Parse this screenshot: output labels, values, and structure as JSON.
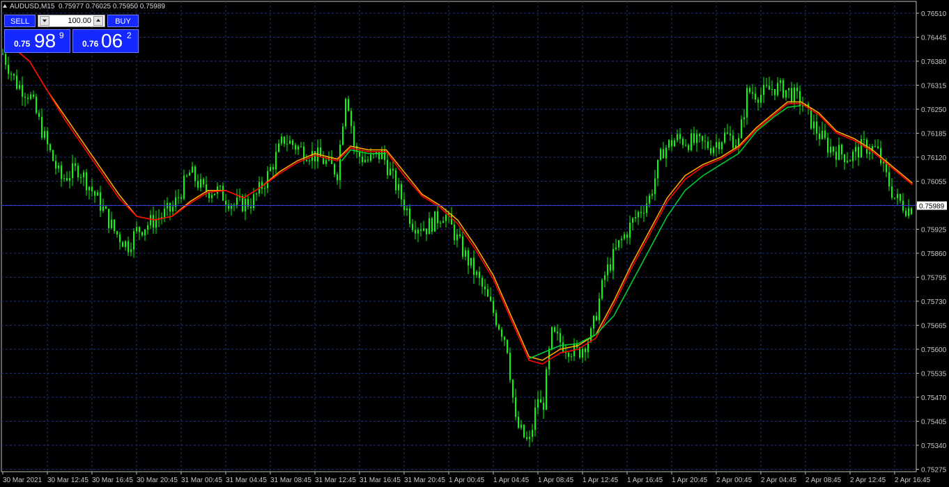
{
  "header": {
    "symbol": "AUDUSD,M15",
    "ohlc": "0.75977 0.76025 0.75950 0.75989"
  },
  "trade_panel": {
    "sell_label": "SELL",
    "buy_label": "BUY",
    "lot_value": "100.00",
    "sell_price": {
      "small": "0.75",
      "big": "98",
      "sup": "9"
    },
    "buy_price": {
      "small": "0.76",
      "big": "06",
      "sup": "2"
    }
  },
  "colors": {
    "background": "#000000",
    "grid": "#23306e",
    "axis": "#c0c0c0",
    "candle": "#00ff00",
    "ma_fast": "#ffa500",
    "ma_slow": "#ff0000",
    "ma_green": "#00cc33",
    "price_line": "#3a3ad0",
    "panel_blue": "#1428ff"
  },
  "chart_data": {
    "type": "candlestick",
    "symbol": "AUDUSD",
    "timeframe": "M15",
    "y_ticks": [
      "0.76510",
      "0.76445",
      "0.76380",
      "0.76315",
      "0.76250",
      "0.76185",
      "0.76120",
      "0.76055",
      "0.75990",
      "0.75925",
      "0.75860",
      "0.75795",
      "0.75730",
      "0.75665",
      "0.75600",
      "0.75535",
      "0.75470",
      "0.75405",
      "0.75340",
      "0.75275"
    ],
    "ylim": [
      0.75275,
      0.7651
    ],
    "x_ticks": [
      "30 Mar 2021",
      "30 Mar 12:45",
      "30 Mar 16:45",
      "30 Mar 20:45",
      "31 Mar 00:45",
      "31 Mar 04:45",
      "31 Mar 08:45",
      "31 Mar 12:45",
      "31 Mar 16:45",
      "31 Mar 20:45",
      "1 Apr 00:45",
      "1 Apr 04:45",
      "1 Apr 08:45",
      "1 Apr 12:45",
      "1 Apr 16:45",
      "1 Apr 20:45",
      "2 Apr 00:45",
      "2 Apr 04:45",
      "2 Apr 08:45",
      "2 Apr 12:45",
      "2 Apr 16:45"
    ],
    "current_price": "0.75989",
    "close_series": [
      {
        "t": 0,
        "v": 0.764
      },
      {
        "t": 0.3,
        "v": 0.7632
      },
      {
        "t": 0.6,
        "v": 0.7629
      },
      {
        "t": 1.0,
        "v": 0.7615
      },
      {
        "t": 1.3,
        "v": 0.7606
      },
      {
        "t": 1.7,
        "v": 0.7609
      },
      {
        "t": 2.0,
        "v": 0.7603
      },
      {
        "t": 2.2,
        "v": 0.7599
      },
      {
        "t": 2.5,
        "v": 0.7592
      },
      {
        "t": 2.8,
        "v": 0.7588
      },
      {
        "t": 3.0,
        "v": 0.7592
      },
      {
        "t": 3.4,
        "v": 0.7595
      },
      {
        "t": 3.8,
        "v": 0.7598
      },
      {
        "t": 4.2,
        "v": 0.7608
      },
      {
        "t": 4.5,
        "v": 0.7603
      },
      {
        "t": 4.8,
        "v": 0.7603
      },
      {
        "t": 5.2,
        "v": 0.7599
      },
      {
        "t": 5.6,
        "v": 0.76
      },
      {
        "t": 5.9,
        "v": 0.7606
      },
      {
        "t": 6.3,
        "v": 0.7617
      },
      {
        "t": 6.7,
        "v": 0.7614
      },
      {
        "t": 7.1,
        "v": 0.7612
      },
      {
        "t": 7.5,
        "v": 0.7608
      },
      {
        "t": 7.7,
        "v": 0.7631
      },
      {
        "t": 7.9,
        "v": 0.7613
      },
      {
        "t": 8.2,
        "v": 0.7611
      },
      {
        "t": 8.5,
        "v": 0.7613
      },
      {
        "t": 8.9,
        "v": 0.7602
      },
      {
        "t": 9.2,
        "v": 0.7594
      },
      {
        "t": 9.5,
        "v": 0.7593
      },
      {
        "t": 9.9,
        "v": 0.7597
      },
      {
        "t": 10.3,
        "v": 0.7587
      },
      {
        "t": 10.7,
        "v": 0.7578
      },
      {
        "t": 11.0,
        "v": 0.757
      },
      {
        "t": 11.3,
        "v": 0.7562
      },
      {
        "t": 11.5,
        "v": 0.754
      },
      {
        "t": 11.8,
        "v": 0.7534
      },
      {
        "t": 12.0,
        "v": 0.7547
      },
      {
        "t": 12.1,
        "v": 0.7543
      },
      {
        "t": 12.3,
        "v": 0.7564
      },
      {
        "t": 12.6,
        "v": 0.7561
      },
      {
        "t": 12.9,
        "v": 0.7559
      },
      {
        "t": 13.2,
        "v": 0.7564
      },
      {
        "t": 13.5,
        "v": 0.758
      },
      {
        "t": 13.8,
        "v": 0.7588
      },
      {
        "t": 14.2,
        "v": 0.7596
      },
      {
        "t": 14.5,
        "v": 0.7601
      },
      {
        "t": 14.8,
        "v": 0.7614
      },
      {
        "t": 15.1,
        "v": 0.7617
      },
      {
        "t": 15.5,
        "v": 0.7616
      },
      {
        "t": 15.9,
        "v": 0.7615
      },
      {
        "t": 16.2,
        "v": 0.7618
      },
      {
        "t": 16.5,
        "v": 0.7616
      },
      {
        "t": 16.7,
        "v": 0.763
      },
      {
        "t": 17.0,
        "v": 0.7629
      },
      {
        "t": 17.3,
        "v": 0.7631
      },
      {
        "t": 17.6,
        "v": 0.763
      },
      {
        "t": 17.9,
        "v": 0.7627
      },
      {
        "t": 18.2,
        "v": 0.762
      },
      {
        "t": 18.5,
        "v": 0.7615
      },
      {
        "t": 18.8,
        "v": 0.7613
      },
      {
        "t": 19.0,
        "v": 0.7612
      },
      {
        "t": 19.3,
        "v": 0.7615
      },
      {
        "t": 19.6,
        "v": 0.7614
      },
      {
        "t": 19.8,
        "v": 0.7607
      },
      {
        "t": 20.0,
        "v": 0.7601
      },
      {
        "t": 20.3,
        "v": 0.7598
      },
      {
        "t": 20.42,
        "v": 0.75989
      }
    ],
    "moving_averages": [
      {
        "color": "#ffa500",
        "points": [
          {
            "t": 0.2,
            "v": 0.7642
          },
          {
            "t": 0.6,
            "v": 0.7638
          },
          {
            "t": 1.0,
            "v": 0.763
          },
          {
            "t": 1.4,
            "v": 0.7623
          },
          {
            "t": 1.8,
            "v": 0.7616
          },
          {
            "t": 2.2,
            "v": 0.7609
          },
          {
            "t": 2.6,
            "v": 0.7602
          },
          {
            "t": 3.0,
            "v": 0.7596
          },
          {
            "t": 3.4,
            "v": 0.7595
          },
          {
            "t": 3.8,
            "v": 0.7596
          },
          {
            "t": 4.2,
            "v": 0.76
          },
          {
            "t": 4.6,
            "v": 0.7603
          },
          {
            "t": 5.0,
            "v": 0.7603
          },
          {
            "t": 5.4,
            "v": 0.7601
          },
          {
            "t": 5.8,
            "v": 0.7604
          },
          {
            "t": 6.2,
            "v": 0.7608
          },
          {
            "t": 6.6,
            "v": 0.7611
          },
          {
            "t": 7.0,
            "v": 0.7613
          },
          {
            "t": 7.5,
            "v": 0.76115
          },
          {
            "t": 7.8,
            "v": 0.7615
          },
          {
            "t": 8.2,
            "v": 0.7614
          },
          {
            "t": 8.6,
            "v": 0.7614
          },
          {
            "t": 9.0,
            "v": 0.7608
          },
          {
            "t": 9.4,
            "v": 0.7602
          },
          {
            "t": 9.8,
            "v": 0.7599
          },
          {
            "t": 10.2,
            "v": 0.7595
          },
          {
            "t": 10.6,
            "v": 0.7588
          },
          {
            "t": 11.0,
            "v": 0.758
          },
          {
            "t": 11.4,
            "v": 0.7569
          },
          {
            "t": 11.8,
            "v": 0.7558
          },
          {
            "t": 12.1,
            "v": 0.7557
          },
          {
            "t": 12.5,
            "v": 0.756
          },
          {
            "t": 12.9,
            "v": 0.7561
          },
          {
            "t": 13.3,
            "v": 0.7564
          },
          {
            "t": 13.7,
            "v": 0.7573
          },
          {
            "t": 14.1,
            "v": 0.7583
          },
          {
            "t": 14.5,
            "v": 0.7592
          },
          {
            "t": 14.9,
            "v": 0.7601
          },
          {
            "t": 15.3,
            "v": 0.7607
          },
          {
            "t": 15.7,
            "v": 0.761
          },
          {
            "t": 16.1,
            "v": 0.7612
          },
          {
            "t": 16.5,
            "v": 0.7615
          },
          {
            "t": 16.9,
            "v": 0.762
          },
          {
            "t": 17.3,
            "v": 0.7624
          },
          {
            "t": 17.6,
            "v": 0.7627
          },
          {
            "t": 17.9,
            "v": 0.7627
          },
          {
            "t": 18.3,
            "v": 0.7624
          },
          {
            "t": 18.7,
            "v": 0.7619
          },
          {
            "t": 19.1,
            "v": 0.7617
          },
          {
            "t": 19.5,
            "v": 0.7614
          },
          {
            "t": 19.9,
            "v": 0.761
          },
          {
            "t": 20.4,
            "v": 0.7605
          }
        ]
      },
      {
        "color": "#ff0000",
        "points": [
          {
            "t": 0.2,
            "v": 0.7642
          },
          {
            "t": 0.6,
            "v": 0.7638
          },
          {
            "t": 1.0,
            "v": 0.763
          },
          {
            "t": 1.4,
            "v": 0.7622
          },
          {
            "t": 1.8,
            "v": 0.7615
          },
          {
            "t": 2.2,
            "v": 0.7608
          },
          {
            "t": 2.6,
            "v": 0.7601
          },
          {
            "t": 3.0,
            "v": 0.7596
          },
          {
            "t": 3.4,
            "v": 0.7595
          },
          {
            "t": 3.8,
            "v": 0.7596
          },
          {
            "t": 4.2,
            "v": 0.75995
          },
          {
            "t": 4.6,
            "v": 0.76025
          },
          {
            "t": 5.0,
            "v": 0.7603
          },
          {
            "t": 5.4,
            "v": 0.7601
          },
          {
            "t": 5.8,
            "v": 0.7604
          },
          {
            "t": 6.2,
            "v": 0.76075
          },
          {
            "t": 6.6,
            "v": 0.76105
          },
          {
            "t": 7.0,
            "v": 0.76125
          },
          {
            "t": 7.5,
            "v": 0.7611
          },
          {
            "t": 7.8,
            "v": 0.76145
          },
          {
            "t": 8.2,
            "v": 0.76135
          },
          {
            "t": 8.6,
            "v": 0.76135
          },
          {
            "t": 9.0,
            "v": 0.7607
          },
          {
            "t": 9.4,
            "v": 0.76015
          },
          {
            "t": 9.8,
            "v": 0.75985
          },
          {
            "t": 10.2,
            "v": 0.7594
          },
          {
            "t": 10.6,
            "v": 0.7587
          },
          {
            "t": 11.0,
            "v": 0.7579
          },
          {
            "t": 11.4,
            "v": 0.7568
          },
          {
            "t": 11.8,
            "v": 0.7557
          },
          {
            "t": 12.1,
            "v": 0.7556
          },
          {
            "t": 12.5,
            "v": 0.7559
          },
          {
            "t": 12.9,
            "v": 0.756
          },
          {
            "t": 13.3,
            "v": 0.7563
          },
          {
            "t": 13.7,
            "v": 0.7572
          },
          {
            "t": 14.1,
            "v": 0.7582
          },
          {
            "t": 14.5,
            "v": 0.7591
          },
          {
            "t": 14.9,
            "v": 0.76
          },
          {
            "t": 15.3,
            "v": 0.7606
          },
          {
            "t": 15.7,
            "v": 0.76095
          },
          {
            "t": 16.1,
            "v": 0.76115
          },
          {
            "t": 16.5,
            "v": 0.76145
          },
          {
            "t": 16.9,
            "v": 0.76195
          },
          {
            "t": 17.3,
            "v": 0.76235
          },
          {
            "t": 17.6,
            "v": 0.76265
          },
          {
            "t": 17.9,
            "v": 0.76265
          },
          {
            "t": 18.3,
            "v": 0.76235
          },
          {
            "t": 18.7,
            "v": 0.76185
          },
          {
            "t": 19.1,
            "v": 0.76165
          },
          {
            "t": 19.5,
            "v": 0.76135
          },
          {
            "t": 19.9,
            "v": 0.76095
          },
          {
            "t": 20.4,
            "v": 0.76045
          }
        ]
      },
      {
        "color": "#00cc33",
        "points": [
          {
            "t": 7.6,
            "v": 0.7611
          },
          {
            "t": 7.8,
            "v": 0.7614
          },
          {
            "t": 8.2,
            "v": 0.7613
          },
          {
            "t": 8.6,
            "v": 0.7613
          },
          {
            "t": 11.8,
            "v": 0.75575
          },
          {
            "t": 12.1,
            "v": 0.7559
          },
          {
            "t": 12.5,
            "v": 0.7561
          },
          {
            "t": 12.9,
            "v": 0.75615
          },
          {
            "t": 13.3,
            "v": 0.7564
          },
          {
            "t": 13.7,
            "v": 0.7569
          },
          {
            "t": 14.1,
            "v": 0.7578
          },
          {
            "t": 14.5,
            "v": 0.7587
          },
          {
            "t": 14.9,
            "v": 0.7596
          },
          {
            "t": 15.3,
            "v": 0.7603
          },
          {
            "t": 15.7,
            "v": 0.7607
          },
          {
            "t": 16.1,
            "v": 0.761
          },
          {
            "t": 16.5,
            "v": 0.7613
          },
          {
            "t": 16.9,
            "v": 0.7619
          },
          {
            "t": 17.3,
            "v": 0.7623
          },
          {
            "t": 17.6,
            "v": 0.76255
          },
          {
            "t": 17.9,
            "v": 0.7626
          }
        ]
      }
    ]
  }
}
